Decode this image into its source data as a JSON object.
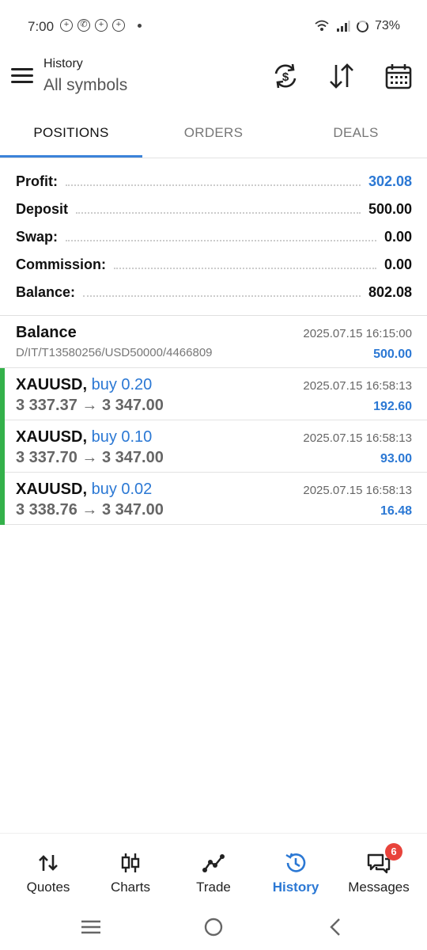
{
  "status_bar": {
    "time": "7:00",
    "battery": "73%",
    "notification_icons": [
      "plus-circle-icon",
      "whatsapp-icon",
      "plus-circle-icon",
      "plus-circle-icon"
    ]
  },
  "header": {
    "title": "History",
    "subtitle": "All symbols"
  },
  "tabs": [
    {
      "label": "POSITIONS",
      "active": true
    },
    {
      "label": "ORDERS",
      "active": false
    },
    {
      "label": "DEALS",
      "active": false
    }
  ],
  "summary": [
    {
      "label": "Profit:",
      "value": "302.08"
    },
    {
      "label": "Deposit",
      "value": "500.00"
    },
    {
      "label": "Swap:",
      "value": "0.00"
    },
    {
      "label": "Commission:",
      "value": "0.00"
    },
    {
      "label": "Balance:",
      "value": "802.08"
    }
  ],
  "balance_entry": {
    "title": "Balance",
    "comment": "D/IT/T13580256/USD50000/4466809",
    "time": "2025.07.15 16:15:00",
    "amount": "500.00"
  },
  "positions": [
    {
      "symbol": "XAUUSD,",
      "side": "buy 0.20",
      "prices": "3 337.37 → 3 347.00",
      "time": "2025.07.15 16:58:13",
      "profit": "192.60"
    },
    {
      "symbol": "XAUUSD,",
      "side": "buy 0.10",
      "prices": "3 337.70 → 3 347.00",
      "time": "2025.07.15 16:58:13",
      "profit": "93.00"
    },
    {
      "symbol": "XAUUSD,",
      "side": "buy 0.02",
      "prices": "3 338.76 → 3 347.00",
      "time": "2025.07.15 16:58:13",
      "profit": "16.48"
    }
  ],
  "bottom_nav": [
    {
      "label": "Quotes",
      "icon": "quotes-arrows-icon",
      "active": false
    },
    {
      "label": "Charts",
      "icon": "candlestick-chart-icon",
      "active": false
    },
    {
      "label": "Trade",
      "icon": "trade-line-icon",
      "active": false
    },
    {
      "label": "History",
      "icon": "history-clock-icon",
      "active": true
    },
    {
      "label": "Messages",
      "icon": "messages-icon",
      "active": false,
      "badge": "6"
    }
  ],
  "colors": {
    "accent": "#2b78d4",
    "buy_stripe": "#34b14a",
    "badge": "#e8433b"
  }
}
